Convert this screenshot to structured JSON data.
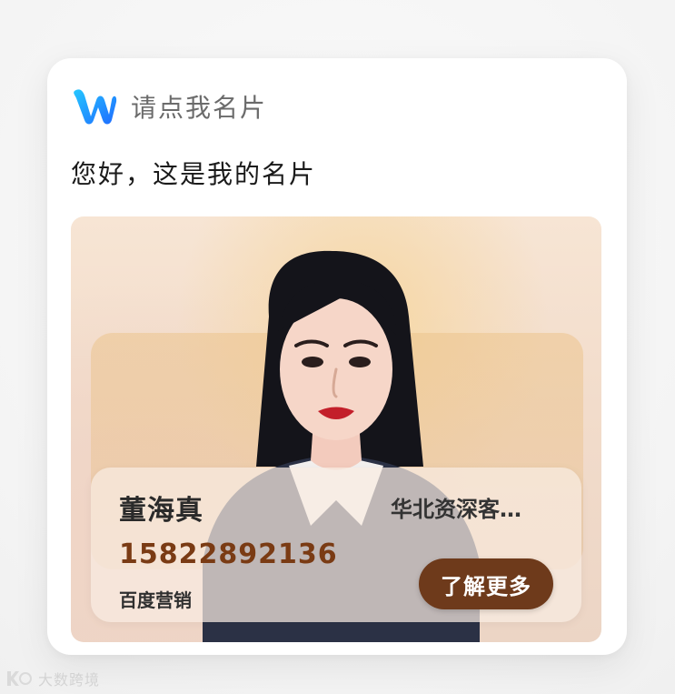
{
  "header": {
    "title": "请点我名片",
    "icon": "app-logo-icon",
    "logo_colors": [
      "#1f6bff",
      "#25c7ff"
    ]
  },
  "message": {
    "text": "您好，这是我的名片"
  },
  "business_card": {
    "name": "董海真",
    "title": "华北资深客…",
    "phone": "15822892136",
    "company": "百度营销",
    "cta_label": "了解更多",
    "accent_color": "#6e3a1b",
    "phone_color": "#7a3b14"
  },
  "watermark": {
    "text": "大数跨境",
    "icon": "watermark-logo-icon"
  }
}
